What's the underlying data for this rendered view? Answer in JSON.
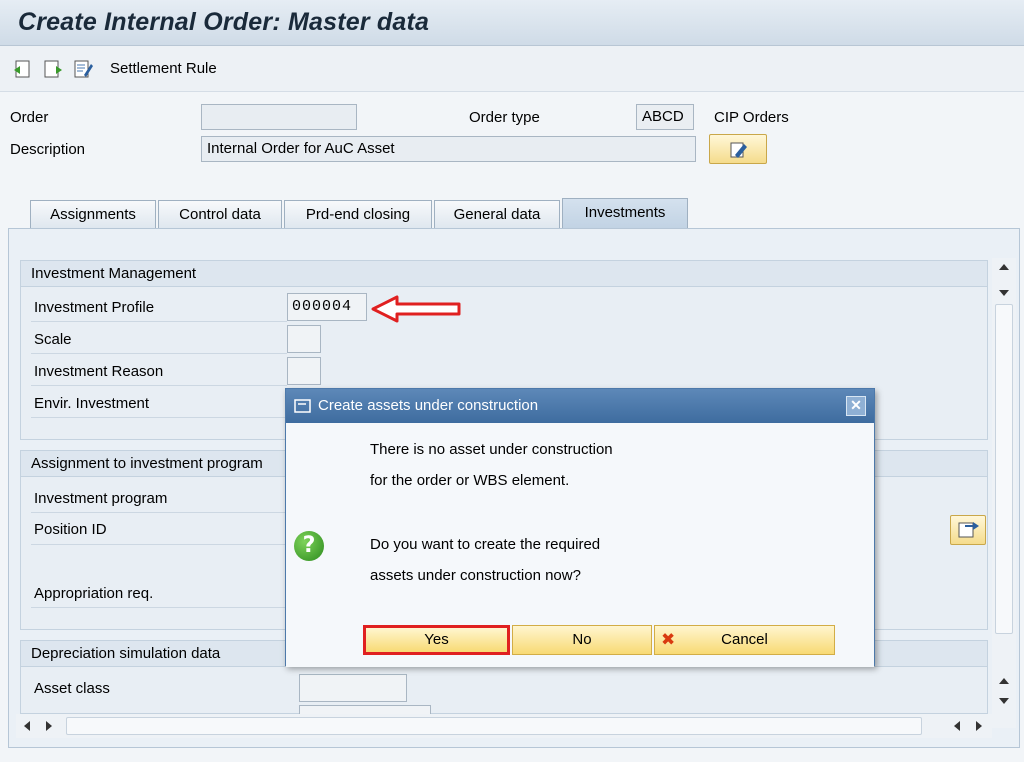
{
  "title": "Create Internal Order: Master data",
  "toolbar": {
    "icons": [
      "back-doc-icon",
      "forward-doc-icon",
      "edit-list-icon"
    ],
    "settlement_rule": "Settlement Rule"
  },
  "header": {
    "order_label": "Order",
    "order_value": "",
    "order_type_label": "Order type",
    "order_type_value": "ABCD",
    "order_type_text": "CIP Orders",
    "description_label": "Description",
    "description_value": "Internal Order for AuC Asset"
  },
  "tabs": [
    {
      "label": "Assignments",
      "active": false
    },
    {
      "label": "Control data",
      "active": false
    },
    {
      "label": "Prd-end closing",
      "active": false
    },
    {
      "label": "General data",
      "active": false
    },
    {
      "label": "Investments",
      "active": true
    }
  ],
  "groups": {
    "investment_management": {
      "title": "Investment Management",
      "investment_profile_label": "Investment Profile",
      "investment_profile_value": "000004",
      "scale_label": "Scale",
      "investment_reason_label": "Investment Reason",
      "envir_investment_label": "Envir. Investment"
    },
    "assignment_program": {
      "title": "Assignment to investment program",
      "investment_program_label": "Investment program",
      "position_id_label": "Position ID",
      "appropriation_req_label": "Appropriation req."
    },
    "depreciation_sim": {
      "title": "Depreciation simulation data",
      "asset_class_label": "Asset class"
    }
  },
  "dialog": {
    "title": "Create assets under construction",
    "line1": "There is no asset under construction",
    "line2": "for the order or WBS element.",
    "line3": "Do you want to create the required",
    "line4": "assets under construction now?",
    "yes": "Yes",
    "no": "No",
    "cancel": "Cancel"
  },
  "colors": {
    "highlight": "#e02020",
    "button": "#f8da74",
    "dialog_title": "#3e6c9f"
  }
}
